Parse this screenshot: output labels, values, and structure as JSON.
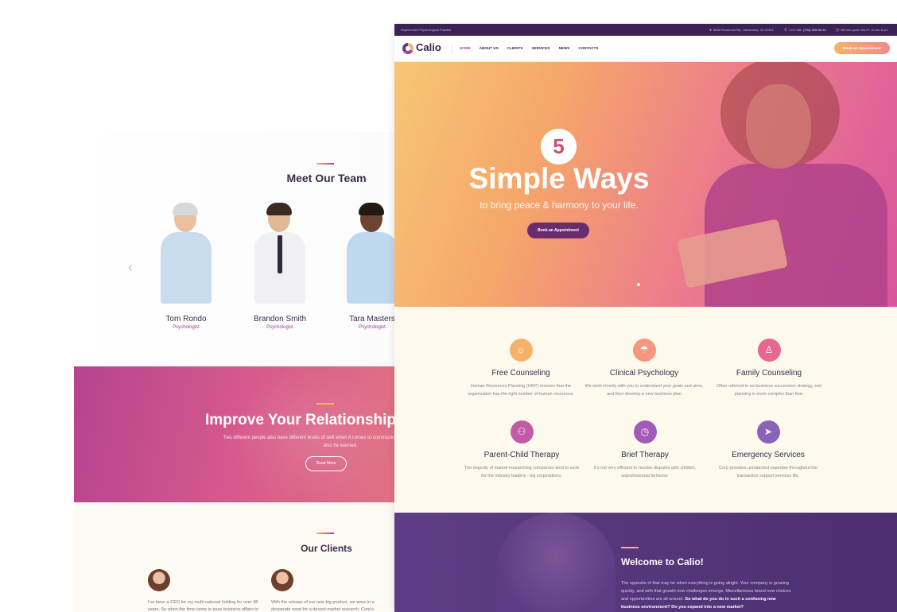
{
  "back_page": {
    "team": {
      "title": "Meet Our Team",
      "prev_arrow": "‹",
      "members": [
        {
          "name": "Tom Rondo",
          "role": "Psychologist"
        },
        {
          "name": "Brandon Smith",
          "role": "Psychologist"
        },
        {
          "name": "Tara Masters",
          "role": "Psychologist"
        }
      ]
    },
    "relationship": {
      "title": "Improve Your Relationship",
      "text": "Two different people also have different levels of skill when it comes to communication, because it is a skill, can also be learned.",
      "button": "Read More"
    },
    "clients": {
      "title": "Our Clients",
      "testimonials": [
        {
          "text": "I've been a CEO for my multi-national holding for over 48 years. So when the time came to pass business affairs to"
        },
        {
          "text": "With the release of our new big product, we were in a desperate need for a decent market research. Corp's"
        }
      ]
    }
  },
  "front_page": {
    "topbar": {
      "tagline": "Experienced Psychological Practice",
      "address": "5656 Richmond Rd., Alexandria, VA 22303",
      "phone_label": "Let's talk:",
      "phone": "(703) 335-06-31",
      "hours": "We are open: Mn-Fr: 10 am-8 pm"
    },
    "header": {
      "logo": "Calio",
      "nav": [
        "HOME",
        "ABOUT US",
        "CLIENTS",
        "SERVICES",
        "NEWS",
        "CONTACTS"
      ],
      "active_nav": "HOME",
      "cta": "Book an Appointment"
    },
    "hero": {
      "badge": "5",
      "title": "Simple Ways",
      "subtitle": "to bring peace & harmony to your life.",
      "button": "Book an Appointment"
    },
    "services": [
      {
        "title": "Free Counseling",
        "text": "Human Resources Planning (HRP) ensures that the organization has the right number of human resources.",
        "icon": "sun-icon",
        "color": "#f6b26b",
        "glyph": "☼"
      },
      {
        "title": "Clinical Psychology",
        "text": "We work closely with you to understand your goals and aims, and then develop a new business plan",
        "icon": "umbrella-icon",
        "color": "#f4977c",
        "glyph": "☂"
      },
      {
        "title": "Family Counseling",
        "text": "Often referred to as business succession strategy, exit planning is more complex than that.",
        "icon": "person-icon",
        "color": "#e7678f",
        "glyph": "♙"
      },
      {
        "title": "Parent-Child Therapy",
        "text": "The majority of market researching companies tend to work for the industry leaders - big corporations.",
        "icon": "people-icon",
        "color": "#c35aa6",
        "glyph": "⚇"
      },
      {
        "title": "Brief Therapy",
        "text": "It's not very efficient to resolve disputes with childish, unprofessional behavior.",
        "icon": "clock-icon",
        "color": "#a25bb8",
        "glyph": "◷"
      },
      {
        "title": "Emergency Services",
        "text": "Corp provides unmatched expertise throughout the transaction support services life.",
        "icon": "paper-plane-icon",
        "color": "#8963b8",
        "glyph": "➤"
      }
    ],
    "welcome": {
      "title": "Welcome to Calio!",
      "text": "The opposite of that may be when everything is going alright. Your company is growing quickly, and with that growth new challenges emerge. Miscellaneous brand new choices and opportunities are all around.",
      "text_bold": "So what do you do in such a confusing new business environment? Do you expand into a new market?"
    }
  }
}
